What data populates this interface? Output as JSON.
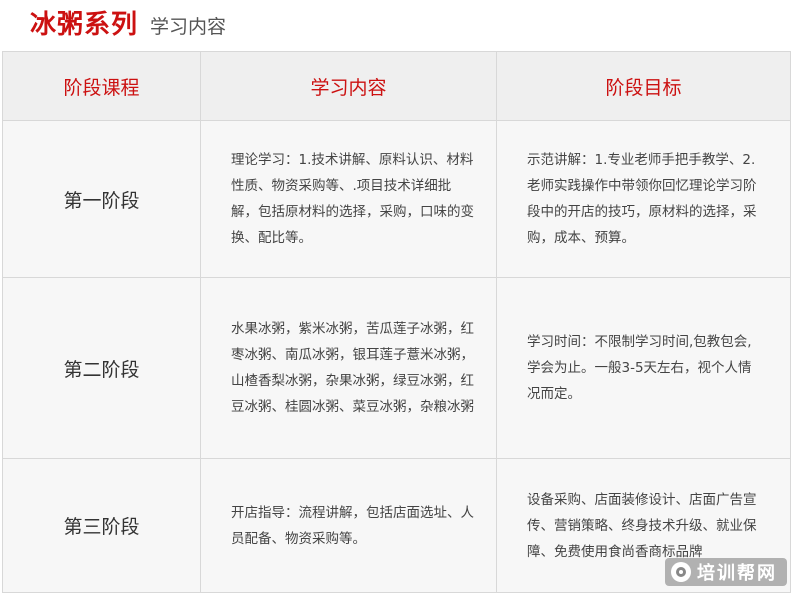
{
  "header": {
    "title": "冰粥系列",
    "subtitle": "学习内容"
  },
  "table": {
    "columns": [
      "阶段课程",
      "学习内容",
      "阶段目标"
    ],
    "rows": [
      {
        "stage": "第一阶段",
        "content": "理论学习：1.技术讲解、原料认识、材料性质、物资采购等、.项目技术详细批解，包括原材料的选择，采购，口味的变换、配比等。",
        "goal": "示范讲解：1.专业老师手把手教学、2.老师实践操作中带领你回忆理论学习阶段中的开店的技巧，原材料的选择，采购，成本、预算。"
      },
      {
        "stage": "第二阶段",
        "content": "水果冰粥，紫米冰粥，苦瓜莲子冰粥，红枣冰粥、南瓜冰粥，银耳莲子薏米冰粥，山楂香梨冰粥，杂果冰粥，绿豆冰粥，红豆冰粥、桂圆冰粥、菜豆冰粥，杂粮冰粥",
        "goal": "学习时间：不限制学习时间,包教包会,学会为止。一般3-5天左右，视个人情况而定。"
      },
      {
        "stage": "第三阶段",
        "content": "开店指导：流程讲解，包括店面选址、人员配备、物资采购等。",
        "goal": "设备采购、店面装修设计、店面广告宣传、营销策略、终身技术升级、就业保障、免费使用食尚香商标品牌"
      }
    ]
  },
  "watermark": {
    "text": "培训帮网"
  },
  "colors": {
    "accent": "#cc1111",
    "header_bg": "#efefef",
    "cell_bg": "#f7f7f7",
    "border": "#d8d8d8"
  }
}
